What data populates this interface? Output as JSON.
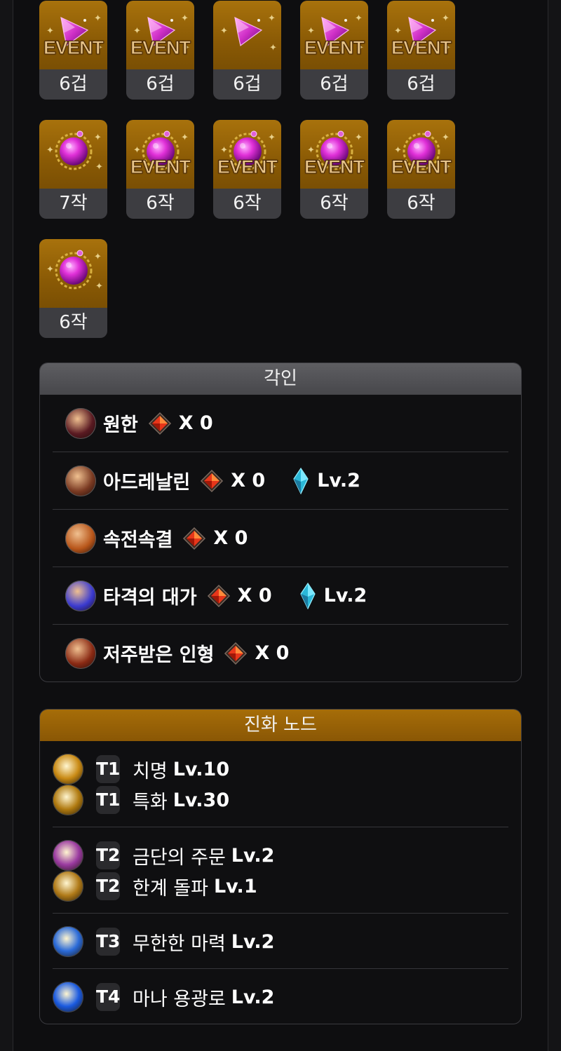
{
  "gems": [
    [
      {
        "type": "dagger",
        "event": true,
        "label": "6겁"
      },
      {
        "type": "dagger",
        "event": true,
        "label": "6겁"
      },
      {
        "type": "dagger",
        "event": false,
        "label": "6겁"
      },
      {
        "type": "dagger",
        "event": true,
        "label": "6겁"
      },
      {
        "type": "dagger",
        "event": true,
        "label": "6겁"
      }
    ],
    [
      {
        "type": "orb",
        "event": false,
        "label": "7작"
      },
      {
        "type": "orb",
        "event": true,
        "label": "6작"
      },
      {
        "type": "orb",
        "event": true,
        "label": "6작"
      },
      {
        "type": "orb",
        "event": true,
        "label": "6작"
      },
      {
        "type": "orb",
        "event": true,
        "label": "6작"
      }
    ],
    [
      {
        "type": "orb",
        "event": false,
        "label": "6작"
      }
    ]
  ],
  "event_text": "EVENT",
  "engravings": {
    "title": "각인",
    "items": [
      {
        "name": "원한",
        "count": "X 0",
        "lv": "",
        "icon": "grudge-icon",
        "color": "#5a1a22"
      },
      {
        "name": "아드레날린",
        "count": "X 0",
        "lv": "Lv.2",
        "icon": "adrenaline-icon",
        "color": "#7a3a22"
      },
      {
        "name": "속전속결",
        "count": "X 0",
        "lv": "",
        "icon": "spirit-absorption-icon",
        "color": "#b8561a"
      },
      {
        "name": "타격의 대가",
        "count": "X 0",
        "lv": "Lv.2",
        "icon": "hit-master-icon",
        "color": "#3a3ad0"
      },
      {
        "name": "저주받은 인형",
        "count": "X 0",
        "lv": "",
        "icon": "cursed-doll-icon",
        "color": "#8a2a14"
      }
    ]
  },
  "evolution": {
    "title": "진화 노드",
    "groups": [
      [
        {
          "tier": "T1",
          "name": "치명",
          "lv": "Lv.10",
          "icon": "crit-icon",
          "color": "#c98a14"
        },
        {
          "tier": "T1",
          "name": "특화",
          "lv": "Lv.30",
          "icon": "specialization-icon",
          "color": "#b07a10"
        }
      ],
      [
        {
          "tier": "T2",
          "name": "금단의 주문",
          "lv": "Lv.2",
          "icon": "forbidden-spell-icon",
          "color": "#9a3aa0"
        },
        {
          "tier": "T2",
          "name": "한계 돌파",
          "lv": "Lv.1",
          "icon": "limit-break-icon",
          "color": "#b07a18"
        }
      ],
      [
        {
          "tier": "T3",
          "name": "무한한 마력",
          "lv": "Lv.2",
          "icon": "infinite-mana-icon",
          "color": "#2a6ad8"
        }
      ],
      [
        {
          "tier": "T4",
          "name": "마나 용광로",
          "lv": "Lv.2",
          "icon": "mana-furnace-icon",
          "color": "#1a5ae0"
        }
      ]
    ]
  }
}
